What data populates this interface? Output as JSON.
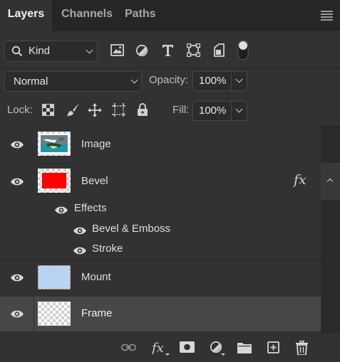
{
  "tabs": [
    {
      "label": "Layers",
      "active": true
    },
    {
      "label": "Channels",
      "active": false
    },
    {
      "label": "Paths",
      "active": false
    }
  ],
  "filter": {
    "kind_label": "Kind",
    "icons": [
      "image-filter-icon",
      "adjustment-filter-icon",
      "type-filter-icon",
      "shape-filter-icon",
      "smart-object-filter-icon",
      "filter-toggle-icon"
    ]
  },
  "blend": {
    "mode": "Normal",
    "opacity_label": "Opacity:",
    "opacity_value": "100%"
  },
  "lock": {
    "label": "Lock:",
    "icons": [
      "lock-transparent-pixels-icon",
      "lock-image-pixels-icon",
      "lock-position-icon",
      "lock-artboard-icon",
      "lock-all-icon"
    ],
    "fill_label": "Fill:",
    "fill_value": "100%"
  },
  "layers": [
    {
      "name": "Image",
      "thumb": "image",
      "visible": true,
      "selected": false
    },
    {
      "name": "Bevel",
      "thumb": "red",
      "visible": true,
      "selected": false,
      "fx": "fx"
    },
    {
      "name": "Effects",
      "type": "effects-header",
      "visible": true
    },
    {
      "name": "Bevel & Emboss",
      "type": "effect",
      "visible": true
    },
    {
      "name": "Stroke",
      "type": "effect",
      "visible": true
    },
    {
      "name": "Mount",
      "thumb": "lightblue",
      "visible": true,
      "selected": false
    },
    {
      "name": "Frame",
      "thumb": "transparent",
      "visible": true,
      "selected": true
    }
  ],
  "bottom_icons": [
    "link-layers-icon",
    "add-layer-style-icon",
    "add-mask-icon",
    "new-adjustment-layer-icon",
    "new-group-icon",
    "new-layer-icon",
    "delete-layer-icon"
  ],
  "colors": {
    "panel_bg": "#323232",
    "tabbar_bg": "#262626",
    "selected_row": "#474747",
    "bevel_thumb": "#ff0000",
    "mount_thumb": "#b9d3f3"
  }
}
